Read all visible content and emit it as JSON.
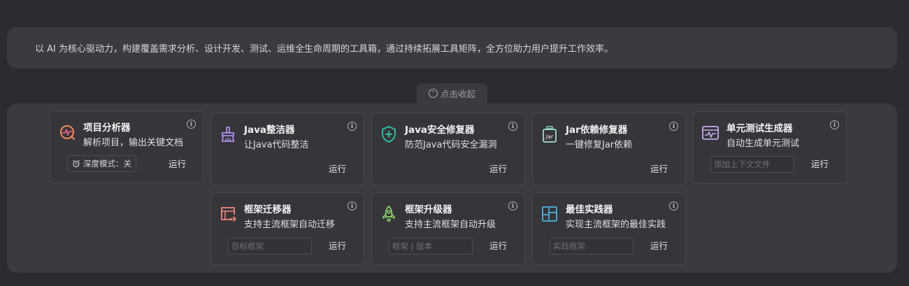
{
  "intro": {
    "text": "以 AI 为核心驱动力，构建覆盖需求分析、设计开发、测试、运维全生命周期的工具箱，通过持续拓展工具矩阵，全方位助力用户提升工作效率。"
  },
  "collapse": {
    "label": "点击收起"
  },
  "colors": {
    "background": "#2c2c30",
    "panel": "#3a3a3f",
    "card": "#35353a",
    "border": "#46464c"
  },
  "tools": {
    "analyzer": {
      "title": "项目分析器",
      "desc": "解析项目，输出关键文档",
      "deep_mode": "深度模式：关",
      "run": "运行",
      "icon": "analyzer-icon"
    },
    "java_cleaner": {
      "title": "Java整洁器",
      "desc": "让Java代码整洁",
      "run": "运行",
      "icon": "broom-icon"
    },
    "java_security": {
      "title": "Java安全修复器",
      "desc": "防范Java代码安全漏洞",
      "run": "运行",
      "icon": "shield-plus-icon"
    },
    "jar_fixer": {
      "title": "Jar依赖修复器",
      "desc": "一键修复Jar依赖",
      "run": "运行",
      "icon": "jar-icon"
    },
    "unit_test": {
      "title": "单元测试生成器",
      "desc": "自动生成单元测试",
      "placeholder": "添加上下文文件",
      "run": "运行",
      "icon": "pulse-window-icon"
    },
    "migrator": {
      "title": "框架迁移器",
      "desc": "支持主流框架自动迁移",
      "placeholder": "目标框架",
      "run": "运行",
      "icon": "migrate-window-icon"
    },
    "upgrader": {
      "title": "框架升级器",
      "desc": "支持主流框架自动升级",
      "placeholder": "框架 | 版本",
      "run": "运行",
      "icon": "rocket-icon"
    },
    "best_practice": {
      "title": "最佳实践器",
      "desc": "实现主流框架的最佳实践",
      "placeholder": "实践框架",
      "run": "运行",
      "icon": "layout-icon"
    }
  }
}
